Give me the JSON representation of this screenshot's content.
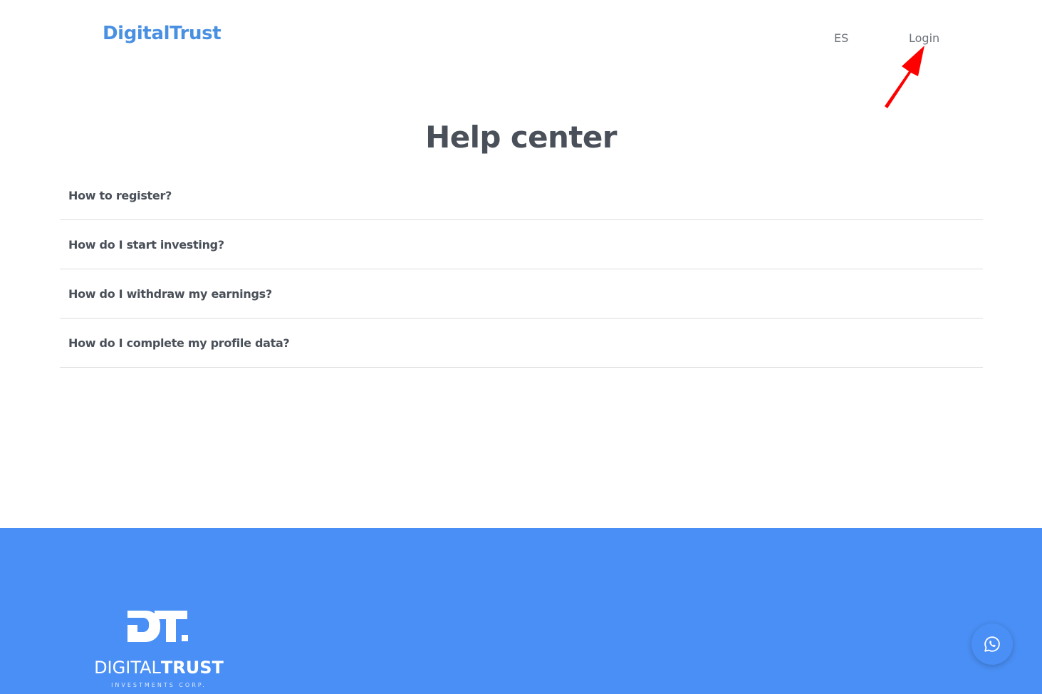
{
  "header": {
    "brand": "DigitalTrust",
    "nav": {
      "language": "ES",
      "login": "Login"
    }
  },
  "main": {
    "title": "Help center",
    "faq": [
      {
        "question": "How to register?"
      },
      {
        "question": "How do I start investing?"
      },
      {
        "question": "How do I withdraw my earnings?"
      },
      {
        "question": "How do I complete my profile data?"
      }
    ]
  },
  "footer": {
    "logo": {
      "monogram": "DT.",
      "name_light": "DIGITAL",
      "name_bold": "TRUST",
      "tagline": "INVESTMENTS CORP."
    },
    "whatsapp_icon": "whatsapp-icon"
  },
  "colors": {
    "brand": "#4a90e2",
    "footer_bg": "#4a8ff5",
    "text_dark": "#4a5059",
    "annotation_arrow": "#ff0000"
  }
}
